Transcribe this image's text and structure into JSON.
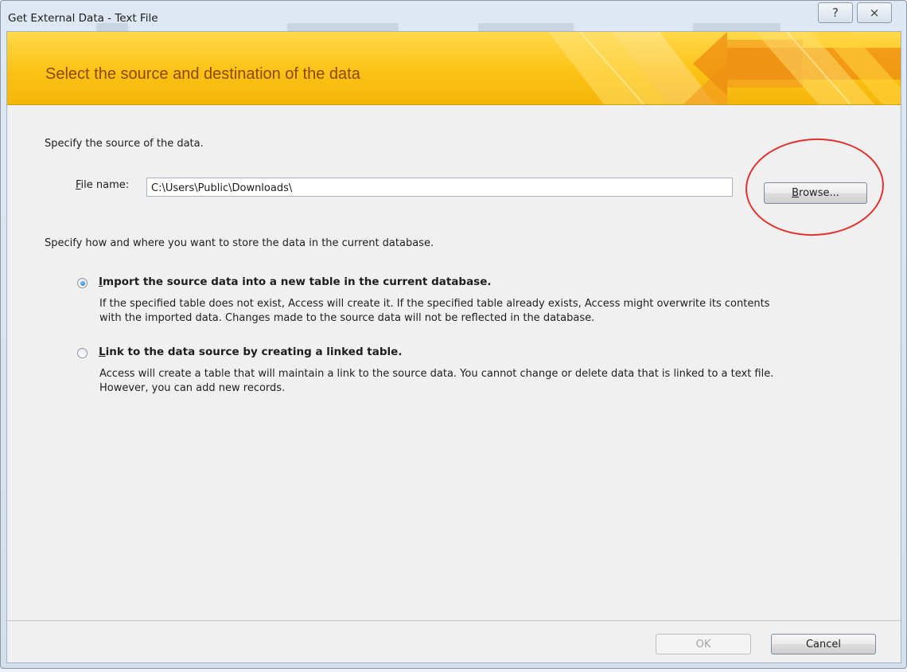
{
  "window": {
    "title": "Get External Data - Text File",
    "help_button": "?",
    "close_button": "⨯"
  },
  "banner": {
    "title": "Select the source and destination of the data"
  },
  "source": {
    "heading": "Specify the source of the data.",
    "file_label_key": "F",
    "file_label_rest": "ile name:",
    "file_value": "C:\\Users\\Public\\Downloads\\",
    "browse_key": "B",
    "browse_rest": "rowse..."
  },
  "store": {
    "heading": "Specify how and where you want to store the data in the current database."
  },
  "options": [
    {
      "key": "I",
      "title_rest": "mport the source data into a new table in the current database.",
      "desc_line1": "If the specified table does not exist, Access will create it. If the specified table already exists, Access might overwrite its contents",
      "desc_line2": "with the imported data. Changes made to the source data will not be reflected in the database.",
      "checked": true
    },
    {
      "key": "L",
      "title_rest": "ink to the data source by creating a linked table.",
      "desc_line1": "Access will create a table that will maintain a link to the source data. You cannot change or delete data that is linked to a text file.",
      "desc_line2": "However, you can add new records.",
      "checked": false
    }
  ],
  "footer": {
    "ok_label": "OK",
    "cancel_label": "Cancel"
  },
  "colors": {
    "banner": "#fdc215",
    "banner_text": "#8a4a00",
    "annotation_circle": "#e0322e"
  }
}
